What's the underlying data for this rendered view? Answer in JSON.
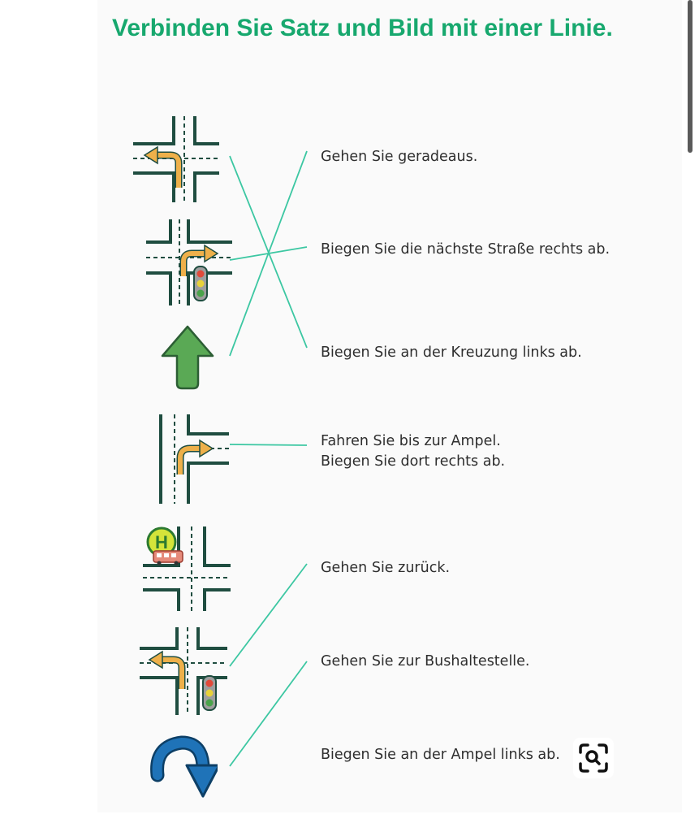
{
  "title": "Verbinden Sie Satz und Bild mit einer Linie.",
  "sentences": [
    {
      "text": "Gehen Sie geradeaus."
    },
    {
      "text": "Biegen Sie die nächste Straße rechts ab."
    },
    {
      "text": "Biegen Sie an der Kreuzung links ab."
    },
    {
      "text": "Fahren Sie bis zur Ampel.\nBiegen Sie dort rechts ab."
    },
    {
      "text": "Gehen Sie zurück."
    },
    {
      "text": "Gehen Sie zur Bushaltestelle."
    },
    {
      "text": "Biegen Sie an der Ampel links ab."
    }
  ],
  "pictures": [
    {
      "icon": "crossroads-left-turn-icon"
    },
    {
      "icon": "crossroads-traffic-light-right-turn-icon"
    },
    {
      "icon": "straight-ahead-arrow-icon"
    },
    {
      "icon": "t-junction-right-turn-icon"
    },
    {
      "icon": "bus-stop-crossroads-icon",
      "badge": "H"
    },
    {
      "icon": "crossroads-traffic-light-left-turn-icon"
    },
    {
      "icon": "u-turn-arrow-icon"
    }
  ],
  "matches": [
    {
      "picture": 1,
      "sentence": 3
    },
    {
      "picture": 2,
      "sentence": 2
    },
    {
      "picture": 3,
      "sentence": 1
    },
    {
      "picture": 4,
      "sentence": 4
    },
    {
      "picture": 6,
      "sentence": 5
    },
    {
      "picture": 7,
      "sentence": 6
    }
  ],
  "colors": {
    "title": "#17a86e",
    "line": "#3cc7a2",
    "road": "#1f4d40",
    "turn_arrow": "#eeb04a",
    "up_arrow": "#5aa955",
    "uturn_arrow": "#1f73b8",
    "bus_badge": "#d4e43a"
  },
  "overlay": {
    "icon": "visual-search-icon"
  }
}
